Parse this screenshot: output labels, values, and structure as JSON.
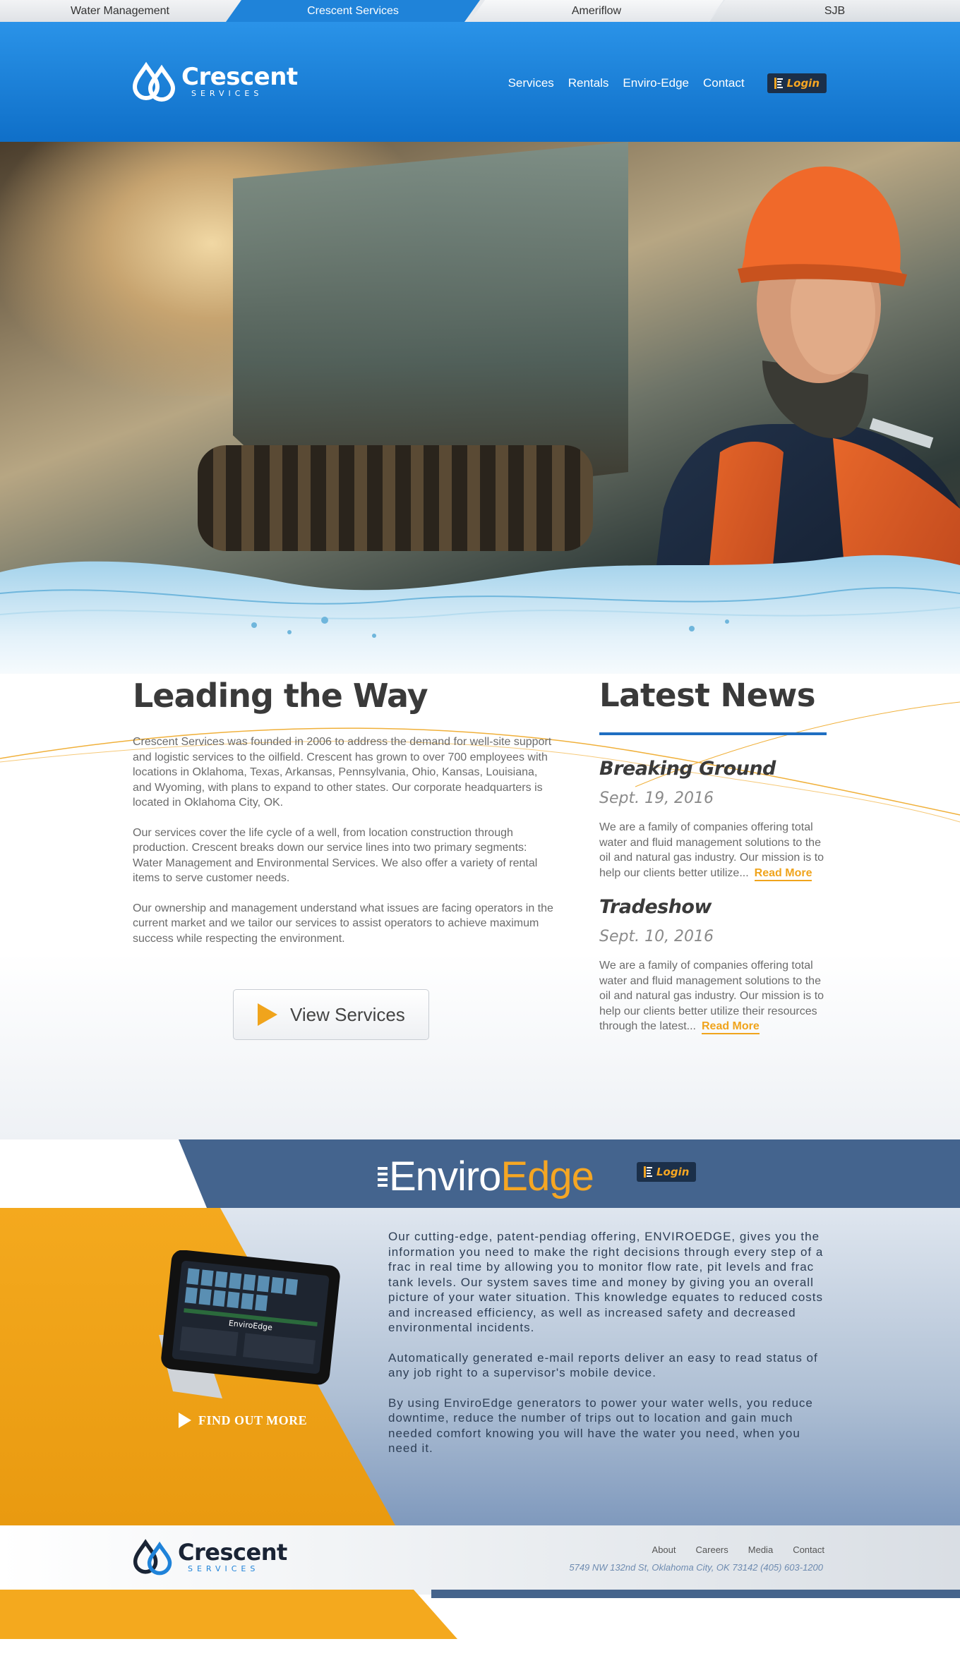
{
  "top_tabs": [
    "Water Management",
    "Crescent Services",
    "Ameriflow",
    "SJB"
  ],
  "header": {
    "logo_name": "Crescent",
    "logo_sub": "SERVICES",
    "nav": [
      "Services",
      "Rentals",
      "Enviro-Edge",
      "Contact"
    ],
    "login": "Login"
  },
  "about": {
    "title": "Leading the Way",
    "paragraphs": [
      "Crescent Services was founded in 2006 to address the demand for well-site support and logistic services to the oilfield. Crescent has grown to over 700 employees with locations in Oklahoma, Texas, Arkansas, Pennsylvania, Ohio, Kansas, Louisiana, and Wyoming, with plans to expand to other states. Our corporate headquarters is located in Oklahoma City, OK.",
      "Our services cover the life cycle of a well, from location construction through production. Crescent breaks down our service lines into two primary segments: Water Management and Environmental Services. We also offer a variety of rental items to serve customer needs.",
      "Our ownership and management understand what issues are facing operators in the current market and we tailor our services to assist operators to achieve maximum success while respecting the environment."
    ],
    "button": "View Services"
  },
  "news": {
    "title": "Latest News",
    "items": [
      {
        "headline": "Breaking Ground",
        "date": "Sept. 19, 2016",
        "text": "We are a family of companies offering total water and fluid management solutions to the oil and natural gas industry. Our mission is to help our clients better utilize...",
        "link": "Read More"
      },
      {
        "headline": "Tradeshow",
        "date": "Sept. 10, 2016",
        "text": "We are a family of companies offering total water and fluid management solutions to the oil and natural gas industry. Our mission is to help our clients better utilize their resources through the latest...",
        "link": "Read More"
      }
    ]
  },
  "enviroedge": {
    "logo_part1": "Enviro",
    "logo_part2": "Edge",
    "login": "Login",
    "find_more": "FIND OUT MORE",
    "tablet_brand": "EnviroEdge",
    "paragraphs": [
      "Our cutting-edge, patent-pendiag offering, ENVIROEDGE, gives you the information you need to make the right decisions through every step of a frac in real time by allowing you to monitor flow rate, pit levels and frac tank levels.  Our system saves time and money by giving you an overall picture of your water situation. This knowledge equates to reduced costs and increased efficiency, as well as increased safety and decreased environmental incidents.",
      "Automatically generated e-mail reports deliver an easy to read status of any job right to a supervisor's  mobile device.",
      "By using EnviroEdge generators to power your water wells, you reduce downtime, reduce the number of trips out to location and gain much needed comfort knowing you will have the water you need, when you need it."
    ]
  },
  "footer": {
    "logo_name": "Crescent",
    "logo_sub": "SERVICES",
    "links": [
      "About",
      "Careers",
      "Media",
      "Contact"
    ],
    "address": "5749 NW 132nd St, Oklahoma City, OK 73142   (405) 603-1200"
  },
  "colors": {
    "brand_blue": "#1f83d9",
    "accent_orange": "#f4a91e",
    "navy": "#44648e"
  }
}
